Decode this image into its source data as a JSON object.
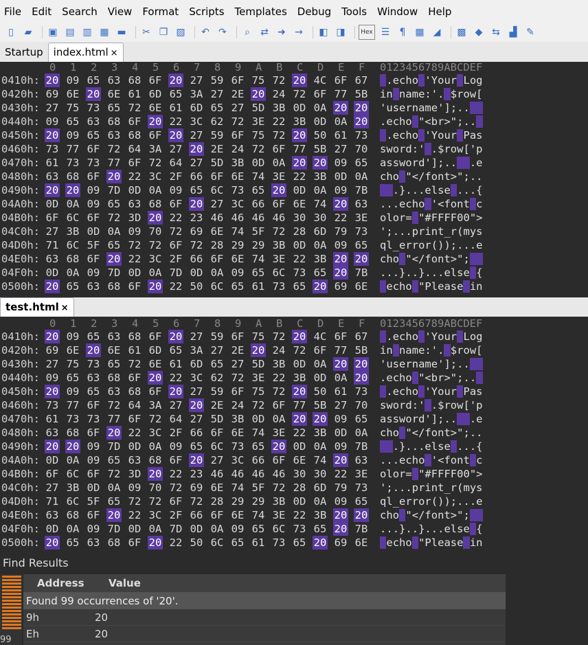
{
  "menu": [
    "File",
    "Edit",
    "Search",
    "View",
    "Format",
    "Scripts",
    "Templates",
    "Debug",
    "Tools",
    "Window",
    "Help"
  ],
  "toolbar_icons": [
    "new-file-icon",
    "open-folder-icon",
    "save-icon",
    "save-all-icon",
    "copy-file-icon",
    "open-file-icon",
    "folder-icon",
    "cut-icon",
    "copy-icon",
    "paste-icon",
    "undo-icon",
    "redo-icon",
    "find-icon",
    "replace-icon",
    "find-next-icon",
    "goto-icon",
    "compare-icon",
    "inspector-icon",
    "hex-icon",
    "columns-icon",
    "pilcrow-icon",
    "grid-icon",
    "highlight-icon",
    "calculator-icon",
    "bookmark-icon",
    "swap-icon",
    "histogram-icon",
    "script-icon"
  ],
  "hex_label": "Hex",
  "tabs_top": [
    {
      "label": "Startup",
      "active": false
    },
    {
      "label": "index.html",
      "active": true
    }
  ],
  "tab_bottom": "test.html",
  "close_glyph": "×",
  "column_header": [
    "0",
    "1",
    "2",
    "3",
    "4",
    "5",
    "6",
    "7",
    "8",
    "9",
    "A",
    "B",
    "C",
    "D",
    "E",
    "F"
  ],
  "ascii_header": "0123456789ABCDEF",
  "search_byte": "20",
  "rows": [
    {
      "addr": "0410h:",
      "bytes": [
        "20",
        "09",
        "65",
        "63",
        "68",
        "6F",
        "20",
        "27",
        "59",
        "6F",
        "75",
        "72",
        "20",
        "4C",
        "6F",
        "67"
      ],
      "ascii": " .echo 'Your Log"
    },
    {
      "addr": "0420h:",
      "bytes": [
        "69",
        "6E",
        "20",
        "6E",
        "61",
        "6D",
        "65",
        "3A",
        "27",
        "2E",
        "20",
        "24",
        "72",
        "6F",
        "77",
        "5B"
      ],
      "ascii": "in name:'. $row["
    },
    {
      "addr": "0430h:",
      "bytes": [
        "27",
        "75",
        "73",
        "65",
        "72",
        "6E",
        "61",
        "6D",
        "65",
        "27",
        "5D",
        "3B",
        "0D",
        "0A",
        "20",
        "20"
      ],
      "ascii": "'username'];..  "
    },
    {
      "addr": "0440h:",
      "bytes": [
        "09",
        "65",
        "63",
        "68",
        "6F",
        "20",
        "22",
        "3C",
        "62",
        "72",
        "3E",
        "22",
        "3B",
        "0D",
        "0A",
        "20"
      ],
      "ascii": ".echo \"<br>\";.. "
    },
    {
      "addr": "0450h:",
      "bytes": [
        "20",
        "09",
        "65",
        "63",
        "68",
        "6F",
        "20",
        "27",
        "59",
        "6F",
        "75",
        "72",
        "20",
        "50",
        "61",
        "73"
      ],
      "ascii": " .echo 'Your Pas"
    },
    {
      "addr": "0460h:",
      "bytes": [
        "73",
        "77",
        "6F",
        "72",
        "64",
        "3A",
        "27",
        "20",
        "2E",
        "24",
        "72",
        "6F",
        "77",
        "5B",
        "27",
        "70"
      ],
      "ascii": "sword:' .$row['p"
    },
    {
      "addr": "0470h:",
      "bytes": [
        "61",
        "73",
        "73",
        "77",
        "6F",
        "72",
        "64",
        "27",
        "5D",
        "3B",
        "0D",
        "0A",
        "20",
        "20",
        "09",
        "65"
      ],
      "ascii": "assword'];..  .e"
    },
    {
      "addr": "0480h:",
      "bytes": [
        "63",
        "68",
        "6F",
        "20",
        "22",
        "3C",
        "2F",
        "66",
        "6F",
        "6E",
        "74",
        "3E",
        "22",
        "3B",
        "0D",
        "0A"
      ],
      "ascii": "cho \"</font>\";.."
    },
    {
      "addr": "0490h:",
      "bytes": [
        "20",
        "20",
        "09",
        "7D",
        "0D",
        "0A",
        "09",
        "65",
        "6C",
        "73",
        "65",
        "20",
        "0D",
        "0A",
        "09",
        "7B"
      ],
      "ascii": "  .}...else ...{"
    },
    {
      "addr": "04A0h:",
      "bytes": [
        "0D",
        "0A",
        "09",
        "65",
        "63",
        "68",
        "6F",
        "20",
        "27",
        "3C",
        "66",
        "6F",
        "6E",
        "74",
        "20",
        "63"
      ],
      "ascii": "...echo '<font c"
    },
    {
      "addr": "04B0h:",
      "bytes": [
        "6F",
        "6C",
        "6F",
        "72",
        "3D",
        "20",
        "22",
        "23",
        "46",
        "46",
        "46",
        "46",
        "30",
        "30",
        "22",
        "3E"
      ],
      "ascii": "olor= \"#FFFF00\">"
    },
    {
      "addr": "04C0h:",
      "bytes": [
        "27",
        "3B",
        "0D",
        "0A",
        "09",
        "70",
        "72",
        "69",
        "6E",
        "74",
        "5F",
        "72",
        "28",
        "6D",
        "79",
        "73"
      ],
      "ascii": "';...print_r(mys"
    },
    {
      "addr": "04D0h:",
      "bytes": [
        "71",
        "6C",
        "5F",
        "65",
        "72",
        "72",
        "6F",
        "72",
        "28",
        "29",
        "29",
        "3B",
        "0D",
        "0A",
        "09",
        "65"
      ],
      "ascii": "ql_error());...e"
    },
    {
      "addr": "04E0h:",
      "bytes": [
        "63",
        "68",
        "6F",
        "20",
        "22",
        "3C",
        "2F",
        "66",
        "6F",
        "6E",
        "74",
        "3E",
        "22",
        "3B",
        "20",
        "20"
      ],
      "ascii": "cho \"</font>\";  "
    },
    {
      "addr": "04F0h:",
      "bytes": [
        "0D",
        "0A",
        "09",
        "7D",
        "0D",
        "0A",
        "7D",
        "0D",
        "0A",
        "09",
        "65",
        "6C",
        "73",
        "65",
        "20",
        "7B"
      ],
      "ascii": "...}..}...else {"
    },
    {
      "addr": "0500h:",
      "bytes": [
        "20",
        "65",
        "63",
        "68",
        "6F",
        "20",
        "22",
        "50",
        "6C",
        "65",
        "61",
        "73",
        "65",
        "20",
        "69",
        "6E"
      ],
      "ascii": " echo \"Please in"
    }
  ],
  "find": {
    "title": "Find Results",
    "col_address": "Address",
    "col_value": "Value",
    "summary": "Found 99 occurrences of '20'.",
    "count": "99",
    "results": [
      {
        "address": "9h",
        "value": "20"
      },
      {
        "address": "Eh",
        "value": "20"
      }
    ]
  },
  "colors": {
    "highlight": "#5b3aa0",
    "background": "#2b2b2b",
    "strip": "#e07820"
  }
}
